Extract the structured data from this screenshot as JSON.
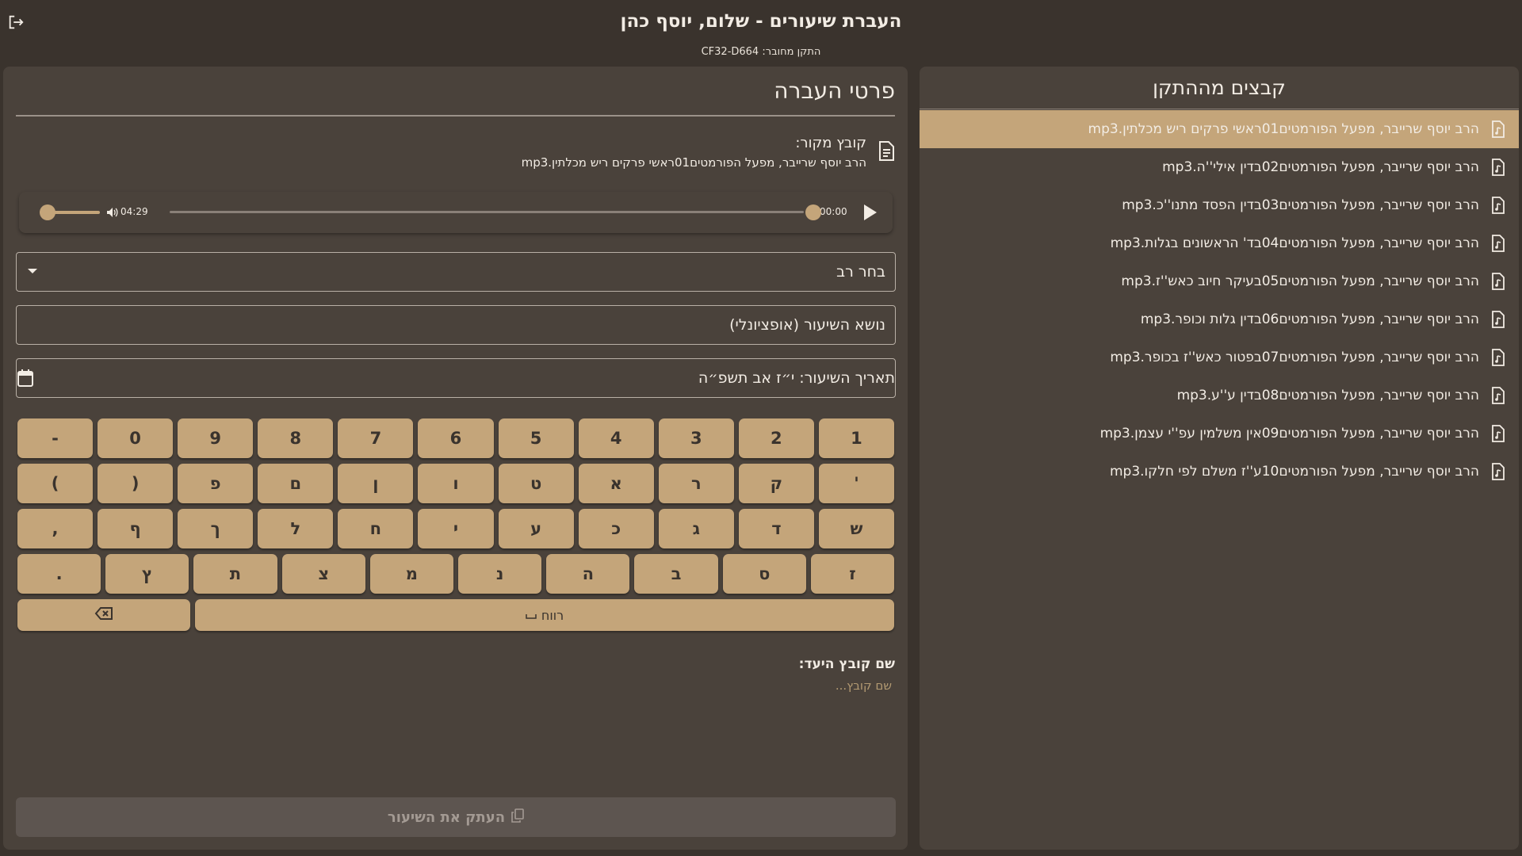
{
  "header": {
    "title": "העברת שיעורים - שלום, יוסף כהן",
    "device_label": "התקן מחובר: CF32-D664"
  },
  "transfer": {
    "title": "פרטי העברה",
    "source_label": "קובץ מקור:",
    "source_file": "הרב יוסף שרייבר, מפעל הפורמטים01ראשי פרקים ריש מכלתין.mp3",
    "player": {
      "current_time": "00:00",
      "duration": "04:29",
      "progress": 1.0,
      "volume": 1.0
    },
    "rabbi_select": "בחר רב",
    "topic_field": "נושא השיעור (אופציונלי)",
    "date_field": "תאריך השיעור: י״ז אב תשפ״ה",
    "target_label": "שם קובץ היעד:",
    "target_placeholder": "שם קובץ...",
    "copy_button": "העתק את השיעור"
  },
  "keyboard": {
    "rows": [
      [
        "1",
        "2",
        "3",
        "4",
        "5",
        "6",
        "7",
        "8",
        "9",
        "0",
        "-"
      ],
      [
        "'",
        "ק",
        "ר",
        "א",
        "ט",
        "ו",
        "ן",
        "ם",
        "פ",
        "(",
        ")"
      ],
      [
        "ש",
        "ד",
        "ג",
        "כ",
        "ע",
        "י",
        "ח",
        "ל",
        "ך",
        "ף",
        ","
      ],
      [
        "ז",
        "ס",
        "ב",
        "ה",
        "נ",
        "מ",
        "צ",
        "ת",
        "ץ",
        "."
      ]
    ],
    "space_label": "רווח"
  },
  "files": {
    "title": "קבצים מההתקן",
    "selected_index": 0,
    "items": [
      "הרב יוסף שרייבר, מפעל הפורמטים01ראשי פרקים ריש מכלתין.mp3",
      "הרב יוסף שרייבר, מפעל הפורמטים02בדין אילי''ה.mp3",
      "הרב יוסף שרייבר, מפעל הפורמטים03בדין הפסד מתנו''כ.mp3",
      "הרב יוסף שרייבר, מפעל הפורמטים04בד' הראשונים בגלות.mp3",
      "הרב יוסף שרייבר, מפעל הפורמטים05בעיקר חיוב כאש''ז.mp3",
      "הרב יוסף שרייבר, מפעל הפורמטים06בדין גלות וכופר.mp3",
      "הרב יוסף שרייבר, מפעל הפורמטים07בפטור כאש''ז בכופר.mp3",
      "הרב יוסף שרייבר, מפעל הפורמטים08בדין ע''ע.mp3",
      "הרב יוסף שרייבר, מפעל הפורמטים09אין משלמין עפ''י עצמן.mp3",
      "הרב יוסף שרייבר, מפעל הפורמטים10ע''ז משלם לפי חלקו.mp3"
    ]
  },
  "icons": {
    "logout": "logout-icon",
    "source": "document-icon",
    "play": "play-icon",
    "volume": "volume-icon",
    "calendar": "calendar-icon",
    "backspace": "backspace-icon",
    "space": "space-icon",
    "copy": "copy-icon",
    "file": "audio-file-icon"
  },
  "colors": {
    "background": "#3a332d",
    "panel": "#4a423b",
    "accent": "#c4a57a",
    "text": "#f2ece4",
    "disabled_button": "#5d5550"
  }
}
